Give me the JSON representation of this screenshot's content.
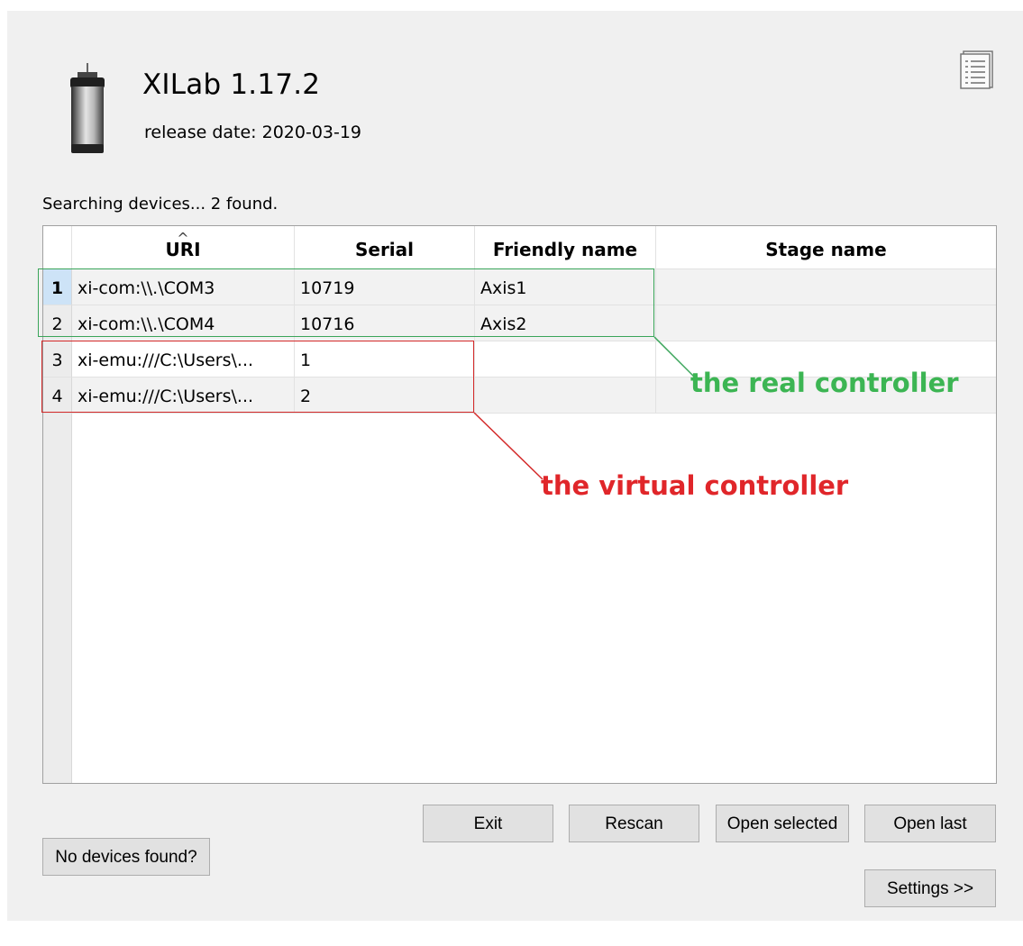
{
  "app": {
    "title": "XILab 1.17.2",
    "release_date": "release date: 2020-03-19"
  },
  "status_text": "Searching devices... 2 found.",
  "table": {
    "columns": [
      "URI",
      "Serial",
      "Friendly name",
      "Stage name"
    ],
    "sorted_column": "URI",
    "rows": [
      {
        "num": "1",
        "uri": "xi-com:\\\\.\\COM3",
        "serial": "10719",
        "friendly": "Axis1",
        "stage": "",
        "selected": true
      },
      {
        "num": "2",
        "uri": "xi-com:\\\\.\\COM4",
        "serial": "10716",
        "friendly": "Axis2",
        "stage": ""
      },
      {
        "num": "3",
        "uri": "xi-emu:///C:\\Users\\...",
        "serial": "1",
        "friendly": "",
        "stage": ""
      },
      {
        "num": "4",
        "uri": "xi-emu:///C:\\Users\\...",
        "serial": "2",
        "friendly": "",
        "stage": ""
      }
    ]
  },
  "annotations": {
    "real": "the real controller",
    "virtual": "the virtual controller",
    "real_color": "#3cb553",
    "virtual_color": "#e0262a"
  },
  "buttons": {
    "exit": "Exit",
    "rescan": "Rescan",
    "open_selected": "Open selected",
    "open_last": "Open last",
    "no_devices": "No devices found?",
    "settings": "Settings >>"
  },
  "icons": {
    "app": "motor-controller-icon",
    "log": "log-list-icon"
  }
}
